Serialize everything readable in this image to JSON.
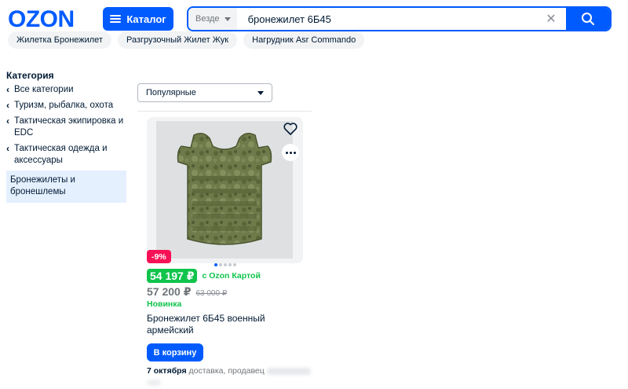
{
  "header": {
    "logo": "OZON",
    "catalog_label": "Каталог",
    "search": {
      "scope": "Везде",
      "query": "бронежилет 6Б45"
    }
  },
  "chips": [
    "Жилетка Бронежилет",
    "Разгрузочный Жилет Жук",
    "Нагрудник Asr Commando"
  ],
  "sidebar": {
    "title": "Категория",
    "items": [
      {
        "label": "Все категории"
      },
      {
        "label": "Туризм, рыбалка, охота"
      },
      {
        "label": "Тактическая экипировка и EDC"
      },
      {
        "label": "Тактическая одежда и аксессуары"
      }
    ],
    "selected": "Бронежилеты и бронешлемы"
  },
  "sort": {
    "selected": "Популярные"
  },
  "product": {
    "discount": "-9%",
    "card_price": "54 197 ₽",
    "card_note": "с Ozon Картой",
    "price": "57 200 ₽",
    "old_price": "63 000 ₽",
    "badge": "Новинка",
    "title": "Бронежилет 6Б45 военный армейский",
    "cart_label": "В корзину",
    "delivery_date": "7 октября",
    "delivery_text": "доставка, продавец",
    "image_count": 5,
    "active_image": 1
  },
  "colors": {
    "brand": "#005bff",
    "sale": "#f91155",
    "green": "#10c44c",
    "selected_bg": "#e5f0ff"
  },
  "icons": [
    "catalog-menu-icon",
    "search-icon",
    "clear-icon",
    "chevron-down-icon",
    "chevron-left-icon",
    "heart-icon",
    "more-icon"
  ]
}
